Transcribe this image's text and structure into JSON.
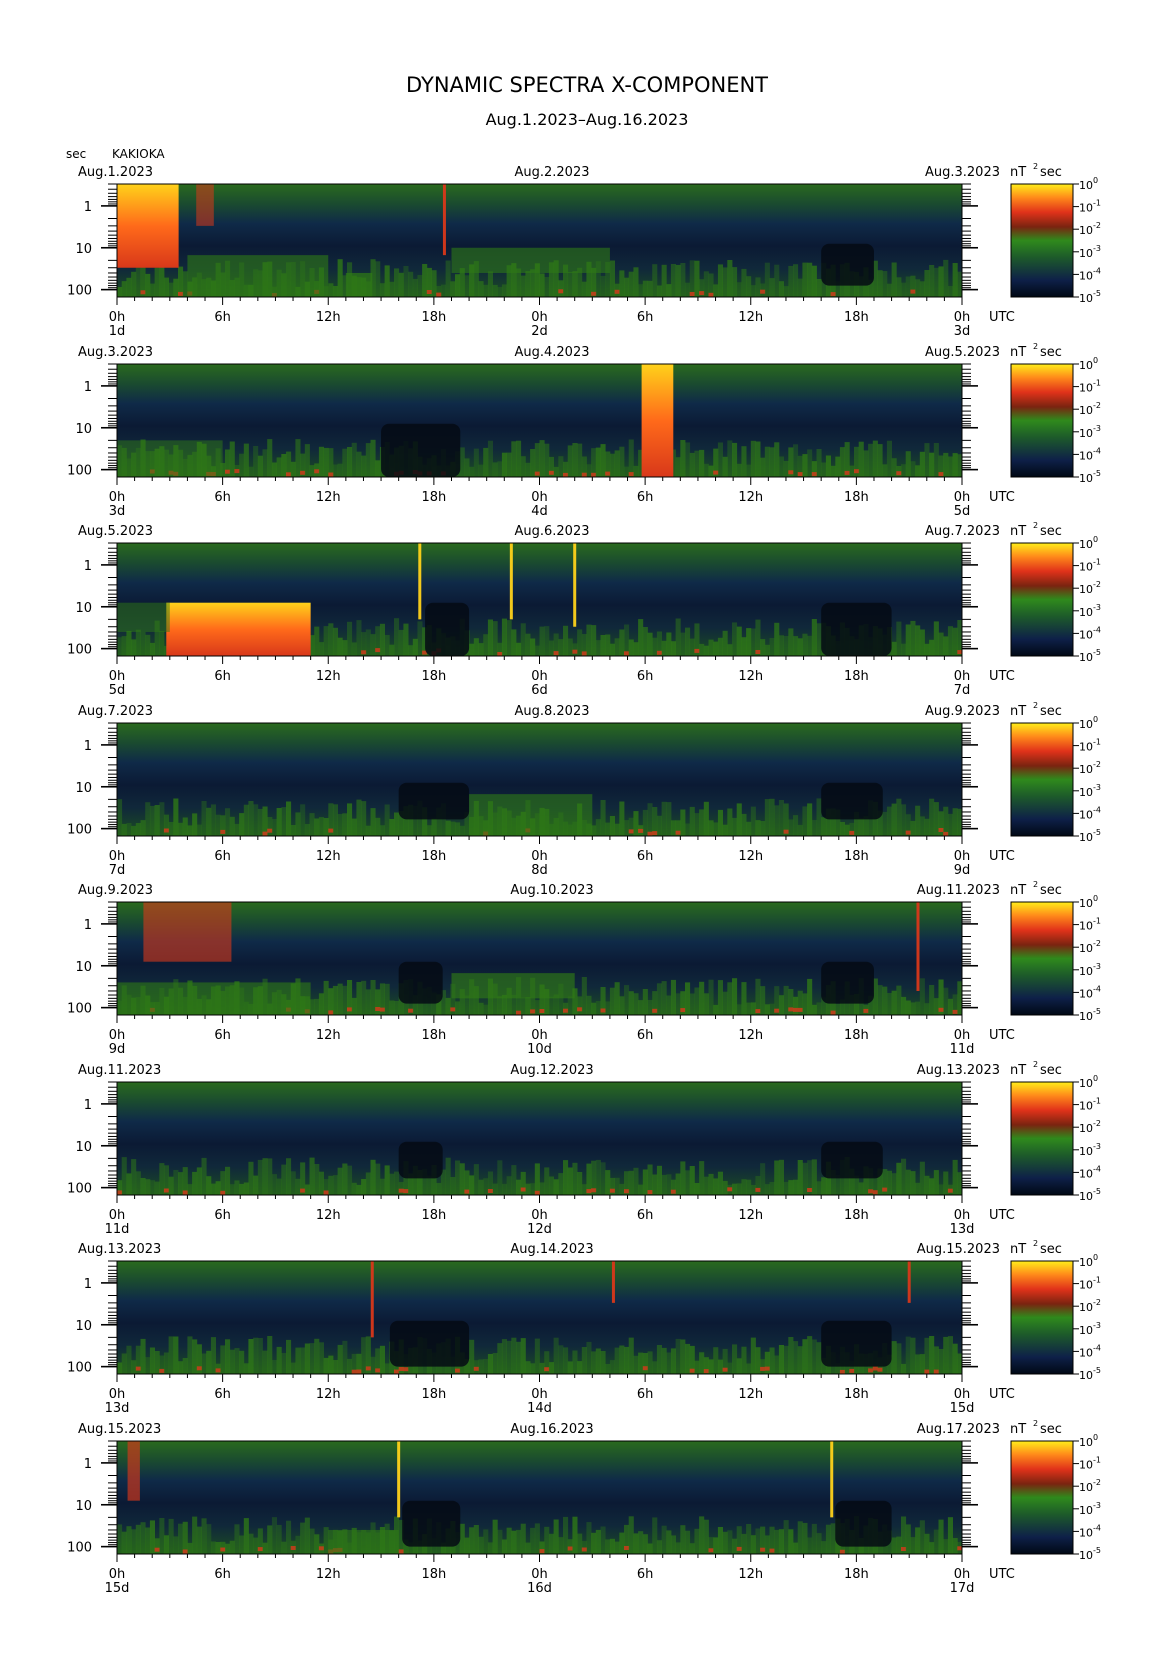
{
  "title": "DYNAMIC SPECTRA X-COMPONENT",
  "subtitle": "Aug.1.2023–Aug.16.2023",
  "ylabel": "sec",
  "station": "KAKIOKA",
  "unit_prefix": "nT",
  "unit_exp": "2",
  "unit_suffix": "sec",
  "utc_label": "UTC",
  "hour_labels": [
    "0h",
    "6h",
    "12h",
    "18h",
    "0h",
    "6h",
    "12h",
    "18h",
    "0h"
  ],
  "period_ticks": [
    "1",
    "10",
    "100"
  ],
  "colorbar_ticks": [
    {
      "base": "10",
      "exp": "0"
    },
    {
      "base": "10",
      "exp": "-1"
    },
    {
      "base": "10",
      "exp": "-2"
    },
    {
      "base": "10",
      "exp": "-3"
    },
    {
      "base": "10",
      "exp": "-4"
    },
    {
      "base": "10",
      "exp": "-5"
    }
  ],
  "colors": {
    "noise_top": "#1f5c1a",
    "noise_mid": "#112e3f",
    "quiet": "#050b14",
    "band": "#2f7a16",
    "burst_low": "#d8381a",
    "burst_high": "#ffd21a"
  },
  "chart_data": {
    "type": "heatmap",
    "title": "DYNAMIC SPECTRA X-COMPONENT",
    "subtitle": "Aug.1.2023–Aug.16.2023",
    "ylabel": "sec",
    "x_unit": "hours UTC",
    "y_scale": "log",
    "y_ticks": [
      1,
      10,
      100
    ],
    "colorbar": {
      "label": "nT² sec",
      "scale": "log",
      "range": [
        1e-05,
        1
      ]
    },
    "panels": [
      {
        "start": "Aug.1.2023",
        "mid": "Aug.2.2023",
        "end": "Aug.3.2023",
        "day_start": "1d",
        "day_mid": "2d",
        "day_end": "3d",
        "events": [
          {
            "type": "burst",
            "t0": 0,
            "t1": 3.5,
            "p_min": 0.3,
            "p_max": 30,
            "intensity": 1.0
          },
          {
            "type": "burst",
            "t0": 4.5,
            "t1": 5.5,
            "p_min": 0.3,
            "p_max": 3,
            "intensity": 0.45
          },
          {
            "type": "spike",
            "t": 18.6,
            "p_min": 0.3,
            "p_max": 15,
            "intensity": 0.6
          },
          {
            "type": "band",
            "t0": 4,
            "t1": 12,
            "p_min": 15,
            "p_max": 150,
            "intensity": 0.6
          },
          {
            "type": "band",
            "t0": 19,
            "t1": 28,
            "p_min": 10,
            "p_max": 40,
            "intensity": 0.6
          },
          {
            "type": "band",
            "t0": 13,
            "t1": 14.5,
            "p_min": 40,
            "p_max": 150,
            "intensity": 0.7
          },
          {
            "type": "quiet",
            "t0": 40,
            "t1": 43,
            "p_min": 8,
            "p_max": 80
          }
        ]
      },
      {
        "start": "Aug.3.2023",
        "mid": "Aug.4.2023",
        "end": "Aug.5.2023",
        "day_start": "3d",
        "day_mid": "4d",
        "day_end": "5d",
        "events": [
          {
            "type": "burst",
            "t0": 29.8,
            "t1": 31.6,
            "p_min": 0.3,
            "p_max": 150,
            "intensity": 1.0
          },
          {
            "type": "quiet",
            "t0": 15,
            "t1": 19.5,
            "p_min": 8,
            "p_max": 150
          },
          {
            "type": "band",
            "t0": 0,
            "t1": 6,
            "p_min": 20,
            "p_max": 150,
            "intensity": 0.5
          }
        ]
      },
      {
        "start": "Aug.5.2023",
        "mid": "Aug.6.2023",
        "end": "Aug.7.2023",
        "day_start": "5d",
        "day_mid": "6d",
        "day_end": "7d",
        "events": [
          {
            "type": "burst",
            "t0": 2.8,
            "t1": 11,
            "p_min": 8,
            "p_max": 150,
            "intensity": 0.9
          },
          {
            "type": "band",
            "t0": 0,
            "t1": 3,
            "p_min": 8,
            "p_max": 40,
            "intensity": 0.5
          },
          {
            "type": "spike",
            "t": 17.2,
            "p_min": 0.3,
            "p_max": 20,
            "intensity": 1.0
          },
          {
            "type": "spike",
            "t": 22.4,
            "p_min": 0.3,
            "p_max": 20,
            "intensity": 1.0
          },
          {
            "type": "spike",
            "t": 26,
            "p_min": 0.3,
            "p_max": 30,
            "intensity": 1.0
          },
          {
            "type": "quiet",
            "t0": 17.5,
            "t1": 20,
            "p_min": 8,
            "p_max": 150
          },
          {
            "type": "quiet",
            "t0": 40,
            "t1": 44,
            "p_min": 8,
            "p_max": 150
          }
        ]
      },
      {
        "start": "Aug.7.2023",
        "mid": "Aug.8.2023",
        "end": "Aug.9.2023",
        "day_start": "7d",
        "day_mid": "8d",
        "day_end": "9d",
        "events": [
          {
            "type": "quiet",
            "t0": 16,
            "t1": 20,
            "p_min": 8,
            "p_max": 60
          },
          {
            "type": "quiet",
            "t0": 40,
            "t1": 43.5,
            "p_min": 8,
            "p_max": 60
          },
          {
            "type": "band",
            "t0": 20,
            "t1": 27,
            "p_min": 15,
            "p_max": 150,
            "intensity": 0.6
          }
        ]
      },
      {
        "start": "Aug.9.2023",
        "mid": "Aug.10.2023",
        "end": "Aug.11.2023",
        "day_start": "9d",
        "day_mid": "10d",
        "day_end": "11d",
        "events": [
          {
            "type": "burst",
            "t0": 1.5,
            "t1": 6.5,
            "p_min": 0.3,
            "p_max": 8,
            "intensity": 0.5
          },
          {
            "type": "band",
            "t0": 0,
            "t1": 11,
            "p_min": 25,
            "p_max": 150,
            "intensity": 0.6
          },
          {
            "type": "band",
            "t0": 19,
            "t1": 26,
            "p_min": 15,
            "p_max": 60,
            "intensity": 0.65
          },
          {
            "type": "spike",
            "t": 45.5,
            "p_min": 0.3,
            "p_max": 40,
            "intensity": 0.7
          },
          {
            "type": "quiet",
            "t0": 16,
            "t1": 18.5,
            "p_min": 8,
            "p_max": 80
          },
          {
            "type": "quiet",
            "t0": 40,
            "t1": 43,
            "p_min": 8,
            "p_max": 80
          }
        ]
      },
      {
        "start": "Aug.11.2023",
        "mid": "Aug.12.2023",
        "end": "Aug.13.2023",
        "day_start": "11d",
        "day_mid": "12d",
        "day_end": "13d",
        "events": [
          {
            "type": "quiet",
            "t0": 16,
            "t1": 18.5,
            "p_min": 8,
            "p_max": 60
          },
          {
            "type": "quiet",
            "t0": 40,
            "t1": 43.5,
            "p_min": 8,
            "p_max": 60
          }
        ]
      },
      {
        "start": "Aug.13.2023",
        "mid": "Aug.14.2023",
        "end": "Aug.15.2023",
        "day_start": "13d",
        "day_mid": "14d",
        "day_end": "15d",
        "events": [
          {
            "type": "spike",
            "t": 14.5,
            "p_min": 0.3,
            "p_max": 20,
            "intensity": 0.7
          },
          {
            "type": "spike",
            "t": 28.2,
            "p_min": 0.3,
            "p_max": 3,
            "intensity": 0.4
          },
          {
            "type": "spike",
            "t": 45,
            "p_min": 0.3,
            "p_max": 3,
            "intensity": 0.4
          },
          {
            "type": "quiet",
            "t0": 15.5,
            "t1": 20,
            "p_min": 8,
            "p_max": 100
          },
          {
            "type": "quiet",
            "t0": 40,
            "t1": 44,
            "p_min": 8,
            "p_max": 100
          }
        ]
      },
      {
        "start": "Aug.15.2023",
        "mid": "Aug.16.2023",
        "end": "Aug.17.2023",
        "day_start": "15d",
        "day_mid": "16d",
        "day_end": "17d",
        "events": [
          {
            "type": "burst",
            "t0": 0.6,
            "t1": 1.3,
            "p_min": 0.3,
            "p_max": 8,
            "intensity": 0.55
          },
          {
            "type": "spike",
            "t": 16,
            "p_min": 0.3,
            "p_max": 20,
            "intensity": 1.0
          },
          {
            "type": "spike",
            "t": 40.6,
            "p_min": 0.3,
            "p_max": 20,
            "intensity": 1.0
          },
          {
            "type": "quiet",
            "t0": 16.2,
            "t1": 19.5,
            "p_min": 8,
            "p_max": 100
          },
          {
            "type": "quiet",
            "t0": 40.8,
            "t1": 44,
            "p_min": 8,
            "p_max": 100
          },
          {
            "type": "band",
            "t0": 12,
            "t1": 16,
            "p_min": 40,
            "p_max": 150,
            "intensity": 0.6
          }
        ]
      }
    ]
  }
}
